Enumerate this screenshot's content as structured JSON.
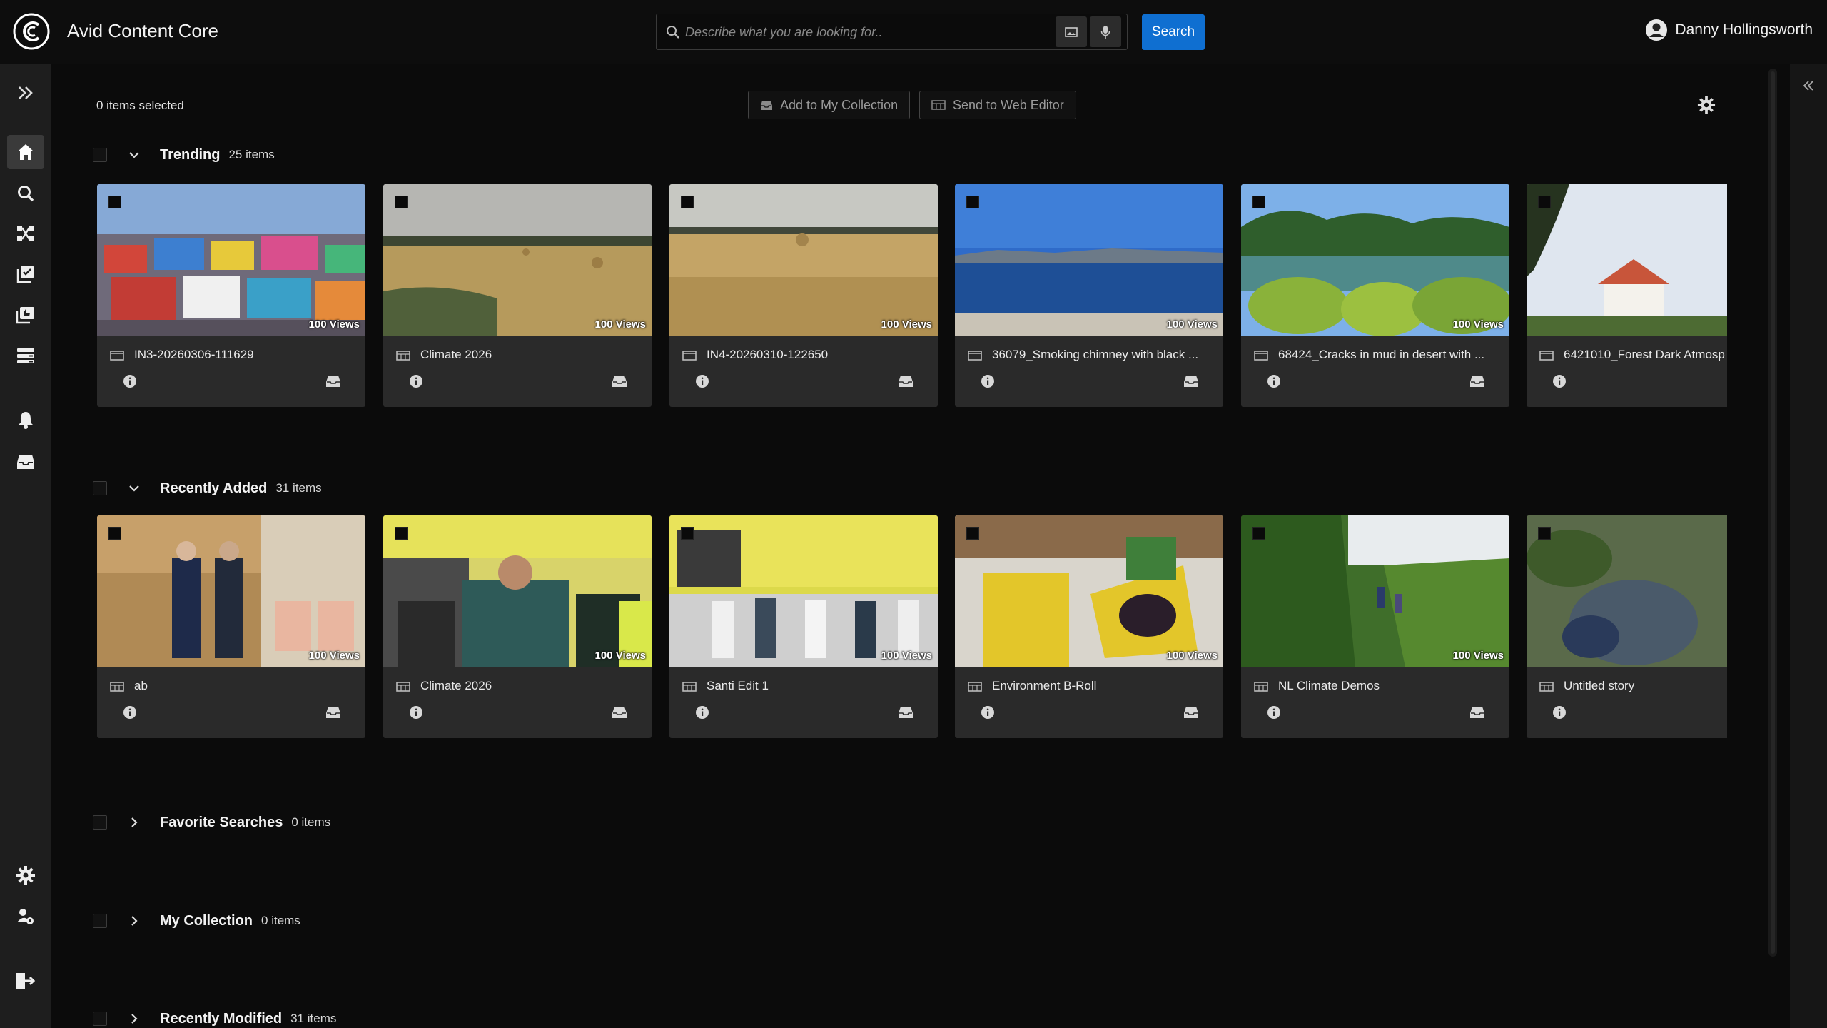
{
  "app": {
    "title": "Avid Content Core"
  },
  "search": {
    "placeholder": "Describe what you are looking for..",
    "button_label": "Search"
  },
  "user": {
    "name": "Danny Hollingsworth"
  },
  "toolbar": {
    "selected_count": "0 items selected",
    "add_to_collection": "Add to My Collection",
    "send_to_web_editor": "Send to Web Editor"
  },
  "colors": {
    "accent": "#0f6fd1",
    "background": "#0b0b0b",
    "card": "#2a2a2a",
    "nav": "#1e1e1e"
  },
  "sections": {
    "trending": {
      "title": "Trending",
      "count": "25 items",
      "expanded": true,
      "cards": [
        {
          "title": "IN3-20260306-111629",
          "views": "100 Views",
          "type_icon": "clip-icon"
        },
        {
          "title": "Climate 2026",
          "views": "100 Views",
          "type_icon": "sequence-icon"
        },
        {
          "title": "IN4-20260310-122650",
          "views": "100 Views",
          "type_icon": "clip-icon"
        },
        {
          "title": "36079_Smoking chimney with black ...",
          "views": "100 Views",
          "type_icon": "clip-icon"
        },
        {
          "title": "68424_Cracks in mud in desert with ...",
          "views": "100 Views",
          "type_icon": "clip-icon"
        },
        {
          "title": "6421010_Forest Dark Atmosp",
          "views": "",
          "type_icon": "clip-icon"
        }
      ]
    },
    "recently_added": {
      "title": "Recently Added",
      "count": "31 items",
      "expanded": true,
      "cards": [
        {
          "title": "ab",
          "views": "100 Views",
          "type_icon": "sequence-icon"
        },
        {
          "title": "Climate 2026",
          "views": "100 Views",
          "type_icon": "sequence-icon"
        },
        {
          "title": "Santi Edit 1",
          "views": "100 Views",
          "type_icon": "sequence-icon"
        },
        {
          "title": "Environment B-Roll",
          "views": "100 Views",
          "type_icon": "sequence-icon"
        },
        {
          "title": "NL Climate Demos",
          "views": "100 Views",
          "type_icon": "sequence-icon"
        },
        {
          "title": "Untitled story",
          "views": "",
          "type_icon": "sequence-icon"
        }
      ]
    },
    "favorite_searches": {
      "title": "Favorite Searches",
      "count": "0 items",
      "expanded": false
    },
    "my_collection": {
      "title": "My Collection",
      "count": "0 items",
      "expanded": false
    },
    "recently_modified": {
      "title": "Recently Modified",
      "count": "31 items",
      "expanded": false
    }
  },
  "nav_icons": [
    "expand-icon",
    "home-icon",
    "search-icon",
    "workflow-icon",
    "tasks-icon",
    "thumbs-icon",
    "list-icon",
    "bell-icon",
    "inbox-icon",
    "settings-icon",
    "user-settings-icon",
    "logout-icon"
  ]
}
